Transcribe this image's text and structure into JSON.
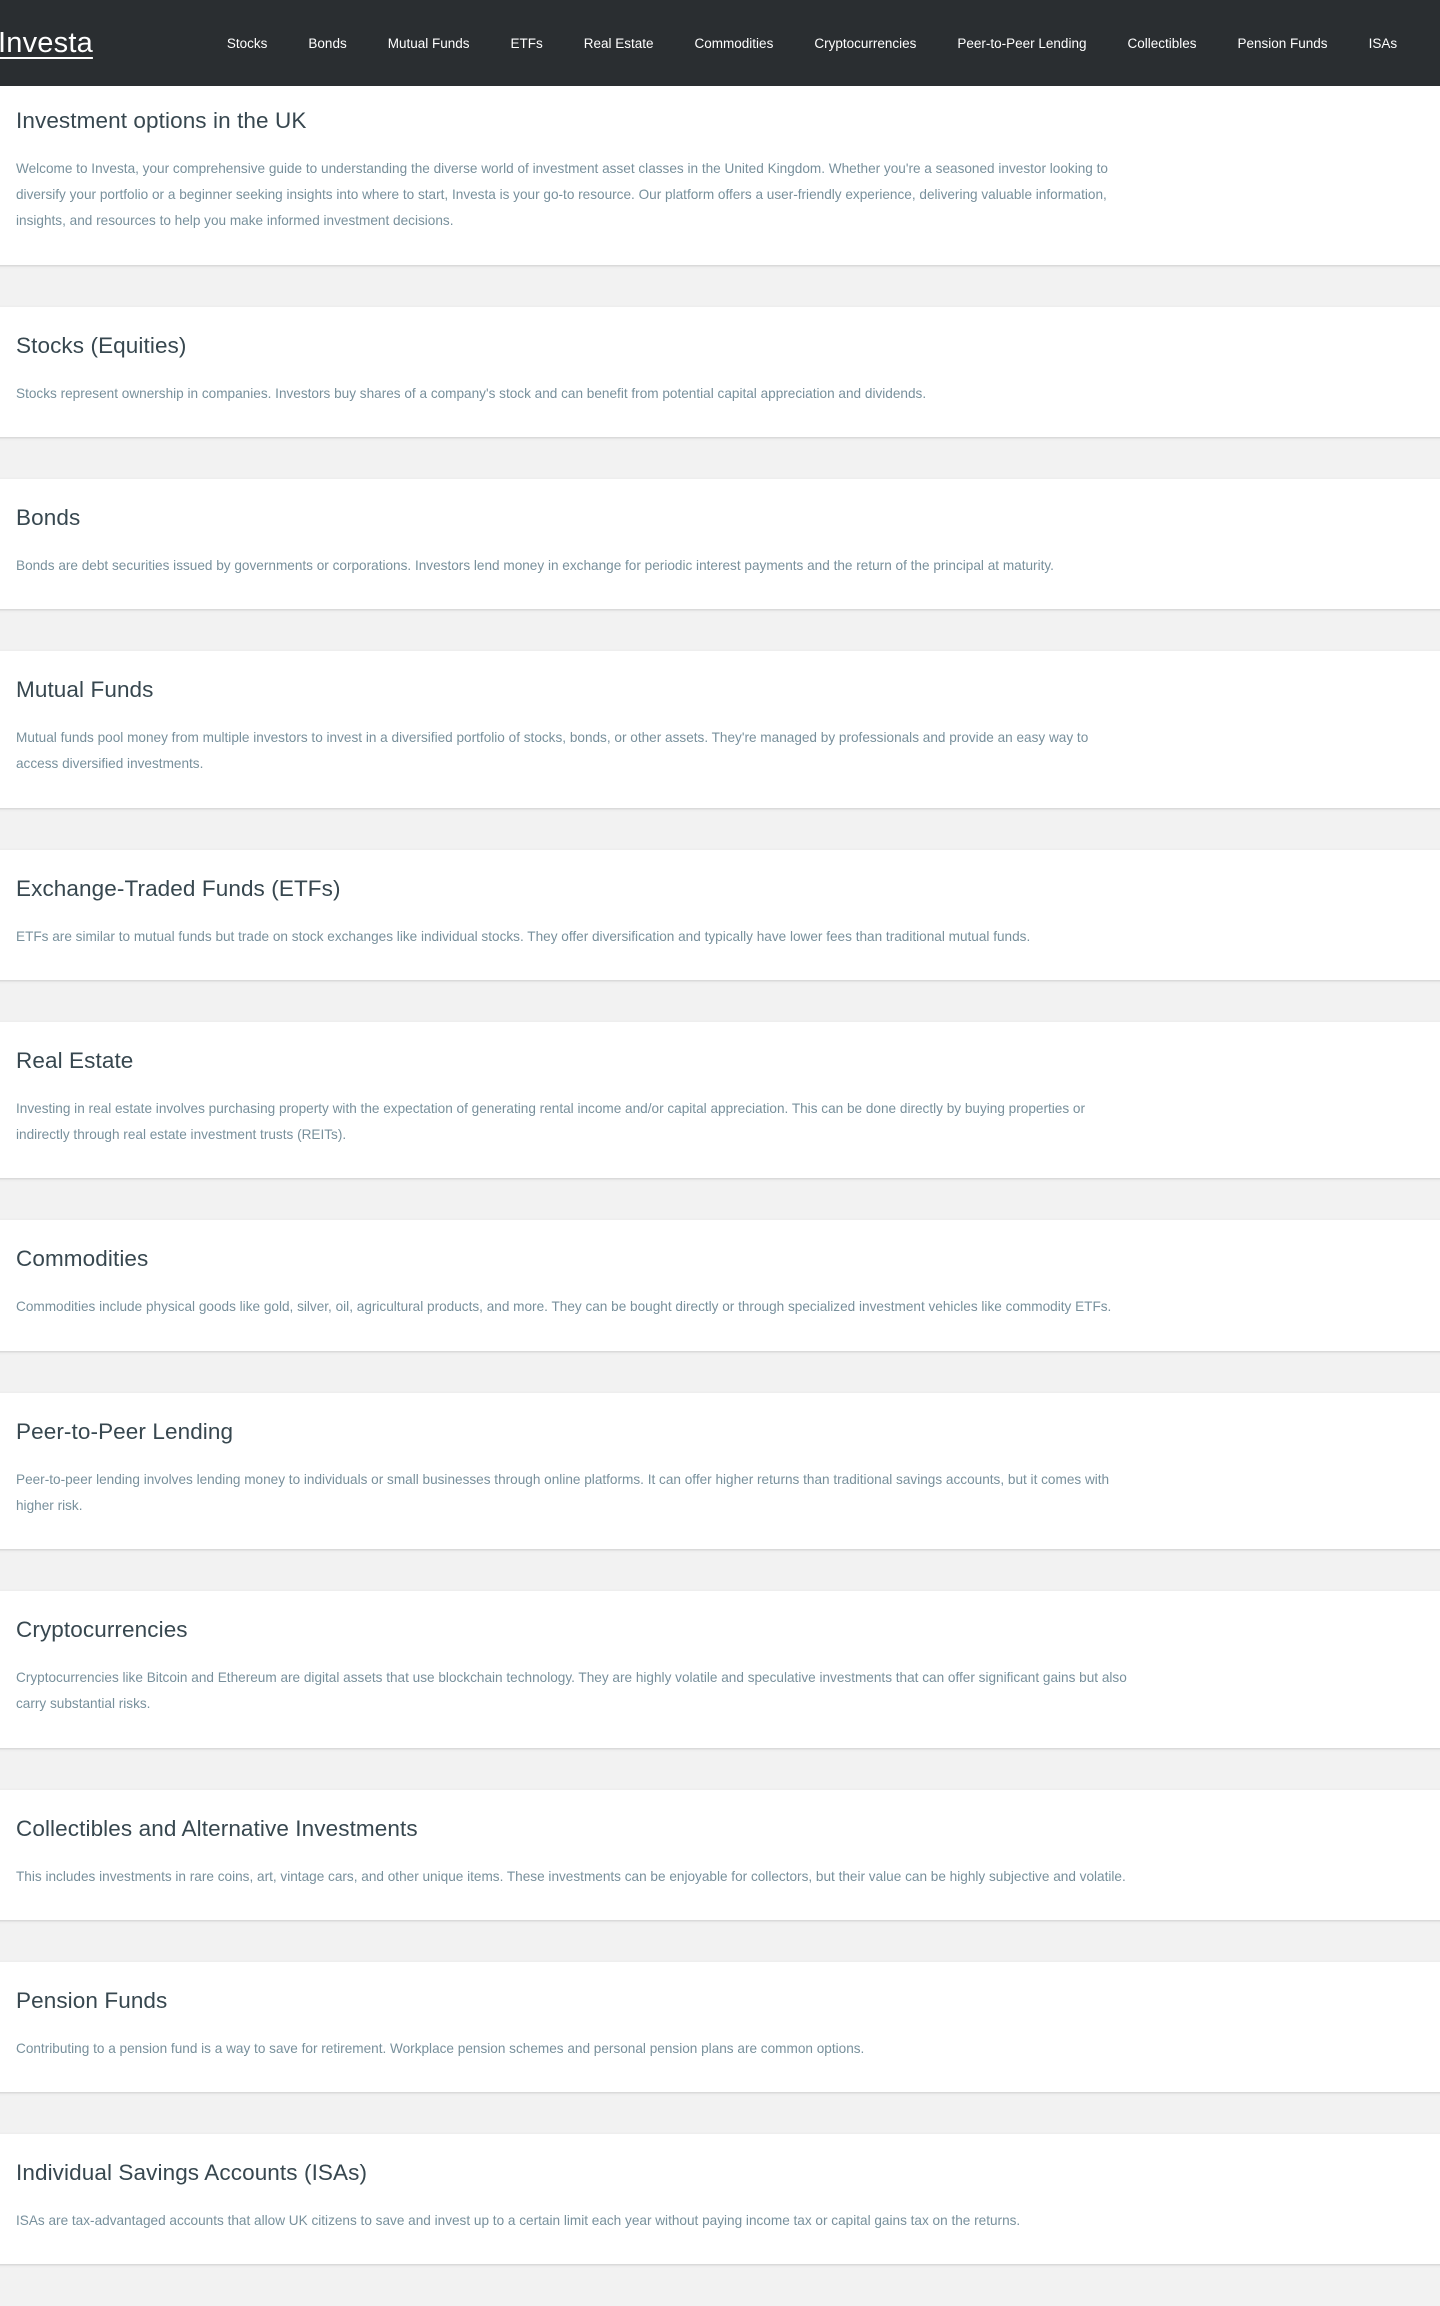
{
  "navbar": {
    "brand": "Investa",
    "links": [
      {
        "label": "Stocks"
      },
      {
        "label": "Bonds"
      },
      {
        "label": "Mutual Funds"
      },
      {
        "label": "ETFs"
      },
      {
        "label": "Real Estate"
      },
      {
        "label": "Commodities"
      },
      {
        "label": "Cryptocurrencies"
      },
      {
        "label": "Peer-to-Peer Lending"
      },
      {
        "label": "Collectibles"
      },
      {
        "label": "Pension Funds"
      },
      {
        "label": "ISAs"
      }
    ],
    "background_color": "#2a2e31",
    "text_color": "#ffffff"
  },
  "page": {
    "background_color": "#f2f2f2",
    "card_color": "#ffffff",
    "heading_color": "#37474f",
    "body_color": "#78909c"
  },
  "intro": {
    "title": "Investment options in the UK",
    "body": "Welcome to Investa, your comprehensive guide to understanding the diverse world of investment asset classes in the United Kingdom. Whether you're a seasoned investor looking to diversify your portfolio or a beginner seeking insights into where to start, Investa is your go-to resource. Our platform offers a user-friendly experience, delivering valuable information, insights, and resources to help you make informed investment decisions."
  },
  "sections": [
    {
      "id": "stocks",
      "title": "Stocks (Equities)",
      "body": "Stocks represent ownership in companies. Investors buy shares of a company's stock and can benefit from potential capital appreciation and dividends."
    },
    {
      "id": "bonds",
      "title": "Bonds",
      "body": "Bonds are debt securities issued by governments or corporations. Investors lend money in exchange for periodic interest payments and the return of the principal at maturity."
    },
    {
      "id": "mutual-funds",
      "title": "Mutual Funds",
      "body": "Mutual funds pool money from multiple investors to invest in a diversified portfolio of stocks, bonds, or other assets. They're managed by professionals and provide an easy way to access diversified investments."
    },
    {
      "id": "etfs",
      "title": "Exchange-Traded Funds (ETFs)",
      "body": "ETFs are similar to mutual funds but trade on stock exchanges like individual stocks. They offer diversification and typically have lower fees than traditional mutual funds."
    },
    {
      "id": "real-estate",
      "title": "Real Estate",
      "body": "Investing in real estate involves purchasing property with the expectation of generating rental income and/or capital appreciation. This can be done directly by buying properties or indirectly through real estate investment trusts (REITs)."
    },
    {
      "id": "commodities",
      "title": "Commodities",
      "body": "Commodities include physical goods like gold, silver, oil, agricultural products, and more. They can be bought directly or through specialized investment vehicles like commodity ETFs."
    },
    {
      "id": "peer-to-peer-lending",
      "title": "Peer-to-Peer Lending",
      "body": "Peer-to-peer lending involves lending money to individuals or small businesses through online platforms. It can offer higher returns than traditional savings accounts, but it comes with higher risk."
    },
    {
      "id": "cryptocurrencies",
      "title": "Cryptocurrencies",
      "body": "Cryptocurrencies like Bitcoin and Ethereum are digital assets that use blockchain technology. They are highly volatile and speculative investments that can offer significant gains but also carry substantial risks."
    },
    {
      "id": "collectibles",
      "title": "Collectibles and Alternative Investments",
      "body": "This includes investments in rare coins, art, vintage cars, and other unique items. These investments can be enjoyable for collectors, but their value can be highly subjective and volatile."
    },
    {
      "id": "pension-funds",
      "title": "Pension Funds",
      "body": "Contributing to a pension fund is a way to save for retirement. Workplace pension schemes and personal pension plans are common options."
    },
    {
      "id": "isas",
      "title": "Individual Savings Accounts (ISAs)",
      "body": "ISAs are tax-advantaged accounts that allow UK citizens to save and invest up to a certain limit each year without paying income tax or capital gains tax on the returns."
    }
  ]
}
